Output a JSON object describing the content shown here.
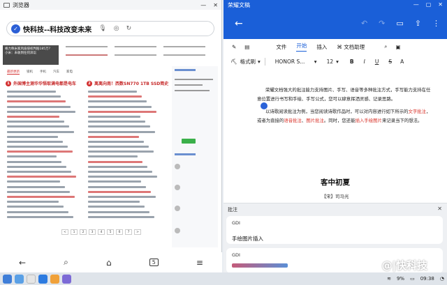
{
  "browser": {
    "window_title": "浏览器",
    "url_text": "快科技--科技改变未来",
    "banner_lines": [
      "格力称米家风扇侵权判赔185万?",
      "小米：未收到任何诉讼"
    ],
    "news_tabs": [
      "最新更新",
      "锁机",
      "手机",
      "汽车",
      "家电"
    ],
    "section1_title": "外国博主测华华悟取满电都是电车",
    "section1_num": "1",
    "section2_title": "离离向南！西数SN770 1TB SSD简史",
    "section2_num": "2",
    "pager": [
      "<",
      "1",
      "2",
      "3",
      "4",
      "5",
      "6",
      "7",
      ">"
    ],
    "nav_icons": [
      "back-icon",
      "search-icon",
      "home-icon",
      "tabs-icon",
      "menu-icon"
    ],
    "nav_glyphs": {
      "back": "←",
      "search": "⌕",
      "home": "⌂",
      "tabs": "5",
      "menu": "≡"
    }
  },
  "docs": {
    "window_title": "荣耀文稿",
    "menu": [
      "文件",
      "开始",
      "插入",
      "文档助理"
    ],
    "style_label": "格式刷",
    "font_name": "HONOR S...",
    "font_size": "12",
    "format_glyphs": [
      "B",
      "I",
      "U",
      "S"
    ],
    "para1": "荣耀文档强大的批注能力支持图片、手写、语音等多种批注方式，手写能力支持在任意位置进行书写和手绘、手写公式，您可以肆意挥洒灵感、记录思路。",
    "para2_a": "以诗歌阅读批注为例，当您阅读诗歌作品时，可以对内容进行如下所示的",
    "para2_b": "文字批注",
    "para2_c": "，或者为直接的",
    "para2_d": "语音批注",
    "para2_e": "、",
    "para2_f": "图片批注",
    "para2_g": "。同时，您还能",
    "para2_h": "插入手绘图片",
    "para2_i": "来记录当下的想法。",
    "poem_title": "客中初夏",
    "poem_author": "【宋】司马光",
    "annotation_header": "批注",
    "annotations": [
      {
        "author": "GDI",
        "text": "手绘图片插入"
      },
      {
        "author": "GDI",
        "text": ""
      }
    ]
  },
  "taskbar": {
    "battery": "9%",
    "time": "09:38",
    "watermark": "@|快科技"
  },
  "colors": {
    "accent_blue": "#1a5fd8",
    "annotation_red": "#d9342b",
    "news_red": "#c62828"
  }
}
